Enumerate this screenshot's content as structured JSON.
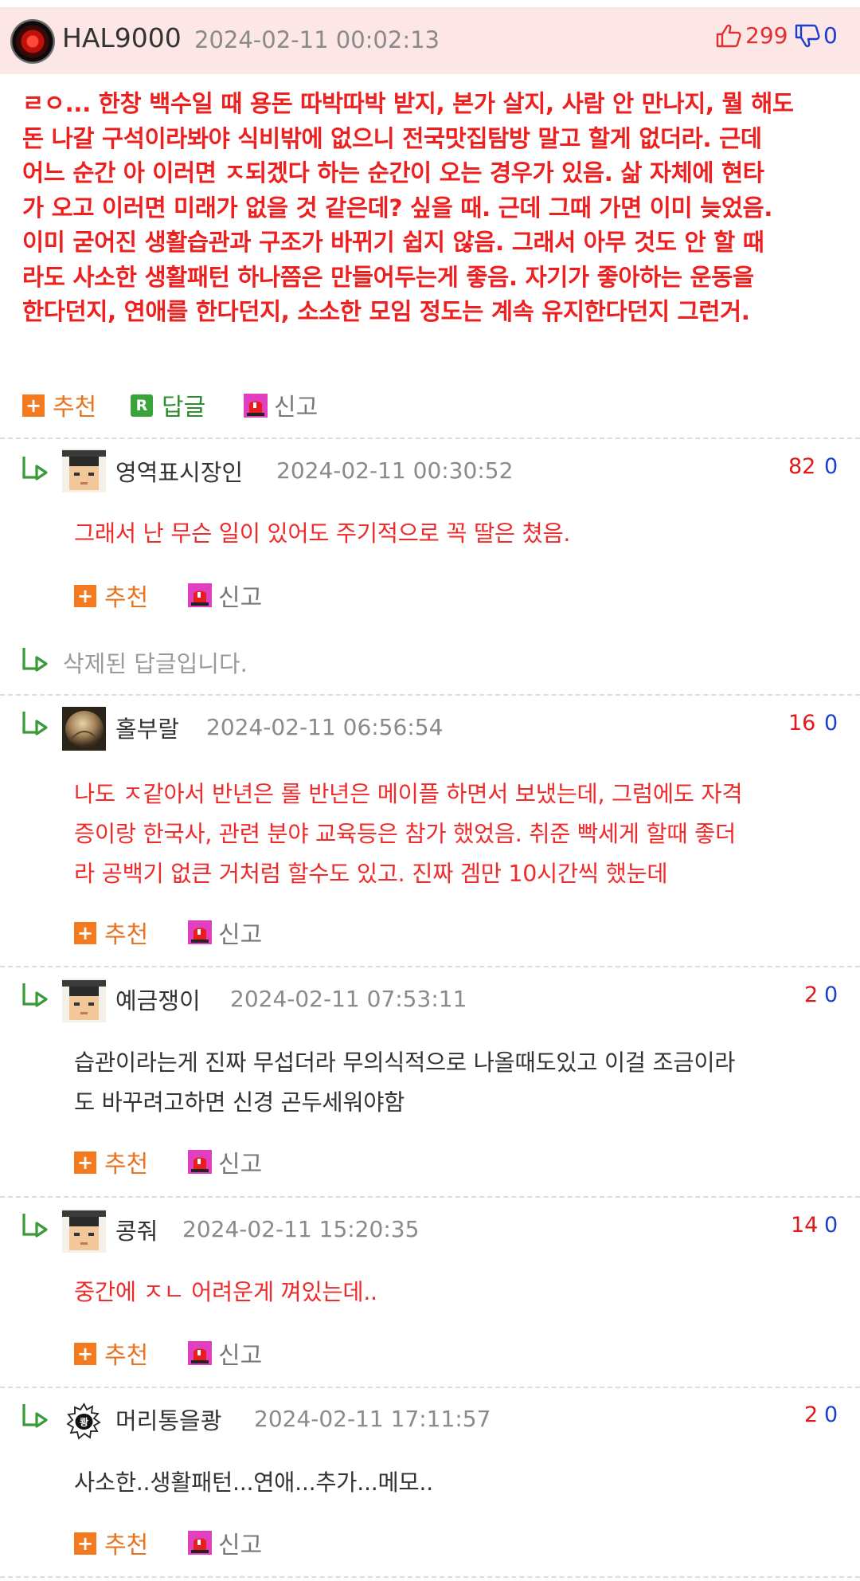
{
  "post": {
    "author": "HAL9000",
    "date": "2024-02-11 00:02:13",
    "likes": "299",
    "dislikes": "0",
    "text": "ㄹㅇ... 한창 백수일 때 용돈 따박따박 받지, 본가 살지, 사람 안 만나지, 뭘 해도\n돈 나갈 구석이라봐야 식비밖에 없으니 전국맛집탐방 말고 할게 없더라. 근데\n어느 순간 아 이러면 ㅈ되겠다 하는 순간이 오는 경우가 있음. 삶 자체에 현타\n가 오고 이러면 미래가 없을 것 같은데? 싶을 때. 근데 그때 가면 이미 늦었음.\n이미 굳어진 생활습관과 구조가 바뀌기 쉽지 않음. 그래서 아무 것도 안 할 때\n라도 사소한 생활패턴 하나쯤은 만들어두는게 좋음. 자기가 좋아하는 운동을\n한다던지, 연애를 한다던지, 소소한 모임 정도는 계속 유지한다던지 그런거.",
    "actions": {
      "recommend": "추천",
      "reply": "답글",
      "report": "신고"
    }
  },
  "action_labels": {
    "recommend": "추천",
    "report": "신고"
  },
  "replies": [
    {
      "author": "영역표시장인",
      "date": "2024-02-11 00:30:52",
      "likes": "82",
      "dislikes": "0",
      "text": "그래서 난 무슨 일이 있어도 주기적으로 꼭 딸은 쳤음.",
      "text_color": "red",
      "avatar": "pixel-avatar"
    },
    {
      "deleted_text": "삭제된 답글입니다."
    },
    {
      "author": "홀부랄",
      "date": "2024-02-11 06:56:54",
      "likes": "16",
      "dislikes": "0",
      "text": "나도 ㅈ같아서 반년은 롤 반년은 메이플 하면서 보냈는데, 그럼에도 자격\n증이랑 한국사, 관련 분야 교육등은 참가 했었음. 취준 빡세게 할때 좋더\n라 공백기 없큰 거처럼 할수도 있고. 진짜 겜만 10시간씩 했눈데",
      "text_color": "red",
      "avatar": "photo-avatar"
    },
    {
      "author": "예금쟁이",
      "date": "2024-02-11 07:53:11",
      "likes": "2",
      "dislikes": "0",
      "text": "습관이라는게 진짜 무섭더라 무의식적으로 나올때도있고 이걸 조금이라\n도 바꾸려고하면 신경 곤두세워야함",
      "text_color": "dark",
      "avatar": "pixel-avatar"
    },
    {
      "author": "콩줘",
      "date": "2024-02-11 15:20:35",
      "likes": "14",
      "dislikes": "0",
      "text": "중간에 ㅈㄴ 어려운게 껴있는데..",
      "text_color": "red",
      "avatar": "pixel-avatar"
    },
    {
      "author": "머리통을쾅",
      "date": "2024-02-11 17:11:57",
      "likes": "2",
      "dislikes": "0",
      "text": "사소한..생활패턴...연애...추가...메모..",
      "text_color": "dark",
      "avatar": "badge-avatar",
      "avatar_text": "쾅"
    }
  ]
}
